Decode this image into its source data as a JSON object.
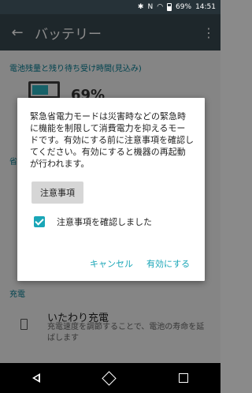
{
  "status_bar": {
    "icons": [
      "bluetooth-icon",
      "nfc-icon",
      "wifi-icon",
      "battery-icon"
    ],
    "battery_percent": "69%",
    "time": "14:51"
  },
  "app_bar": {
    "title": "バッテリー"
  },
  "background": {
    "section_header": "電池残量と残り待ち受け時間(見込み)",
    "battery_percent": "69%",
    "truncated_header": "省",
    "section_charging": "充電",
    "row": {
      "title": "いたわり充電",
      "subtitle": "充電速度を調節することで、電池の寿命を延ばします"
    }
  },
  "dialog": {
    "message": "緊急省電力モードは災害時などの緊急時に機能を制限して消費電力を抑えるモードです。有効にする前に注意事項を確認してください。有効にすると機器の再起動が行われます。",
    "notice_button": "注意事項",
    "checkbox_label": "注意事項を確認しました",
    "checkbox_checked": true,
    "cancel_button": "キャンセル",
    "enable_button": "有効にする"
  },
  "colors": {
    "accent": "#1aa6b7",
    "app_bar": "#37474f",
    "status_bar": "#263238"
  }
}
